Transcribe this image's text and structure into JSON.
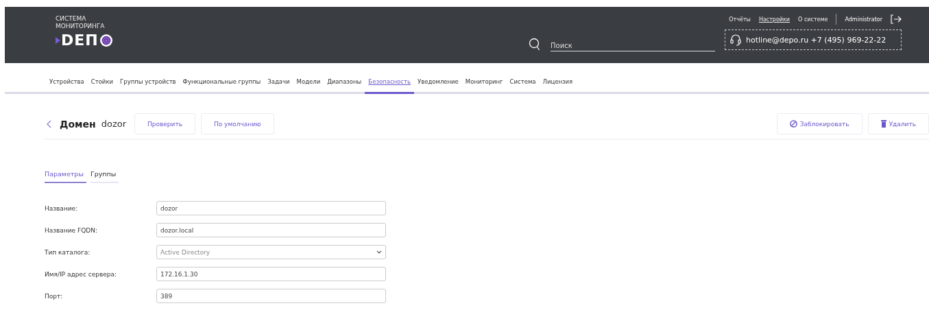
{
  "header": {
    "logo_caption": "СИСТЕМА МОНИТОРИНГА",
    "logo_text": "DEП",
    "top_links": [
      {
        "label": "Отчёты",
        "selected": false
      },
      {
        "label": "Настройки",
        "selected": true
      },
      {
        "label": "О системе",
        "selected": false
      }
    ],
    "user": "Administrator",
    "search": {
      "placeholder": "Поиск"
    },
    "hotline": "hotline@depo.ru +7 (495) 969-22-22"
  },
  "nav": [
    {
      "label": "Устройства",
      "selected": false
    },
    {
      "label": "Стойки",
      "selected": false
    },
    {
      "label": "Группы устройств",
      "selected": false
    },
    {
      "label": "Функциональные группы",
      "selected": false
    },
    {
      "label": "Задачи",
      "selected": false
    },
    {
      "label": "Модели",
      "selected": false
    },
    {
      "label": "Диапазоны",
      "selected": false
    },
    {
      "label": "Безопасность",
      "selected": true
    },
    {
      "label": "Уведомление",
      "selected": false
    },
    {
      "label": "Мониторинг",
      "selected": false
    },
    {
      "label": "Система",
      "selected": false
    },
    {
      "label": "Лицензия",
      "selected": false
    }
  ],
  "page": {
    "title_bold": "Домен",
    "title_name": "dozor",
    "actions": [
      "Проверить",
      "По умолчанию"
    ],
    "right_actions": [
      {
        "kind": "block",
        "label": "Заблокировать"
      },
      {
        "kind": "delete",
        "label": "Удалить"
      }
    ]
  },
  "tabs": [
    {
      "label": "Параметры",
      "selected": true
    },
    {
      "label": "Группы",
      "selected": false
    }
  ],
  "form": [
    {
      "kind": "text",
      "label": "Название:",
      "value": "dozor"
    },
    {
      "kind": "text",
      "label": "Название FQDN:",
      "value": "dozor.local"
    },
    {
      "kind": "select",
      "label": "Тип каталога:",
      "value": "Active Directory"
    },
    {
      "kind": "text",
      "label": "Имя/IP адрес сервера:",
      "value": "172.16.1.30"
    },
    {
      "kind": "text",
      "label": "Порт:",
      "value": "389"
    }
  ]
}
